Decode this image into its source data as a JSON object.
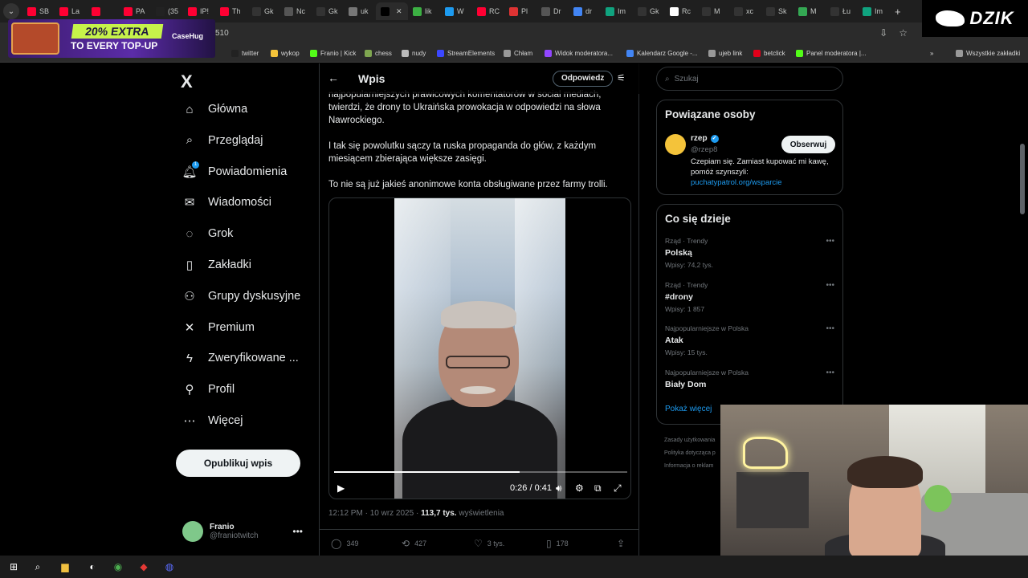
{
  "browser": {
    "tabs": [
      {
        "label": "SB",
        "color": "#ff0033"
      },
      {
        "label": "La",
        "color": "#ff0033"
      },
      {
        "label": "",
        "color": "#ff0033"
      },
      {
        "label": "PA",
        "color": "#ff0033"
      },
      {
        "label": "(35",
        "color": "#222222"
      },
      {
        "label": "IP!",
        "color": "#ff0033"
      },
      {
        "label": "Th",
        "color": "#ff0033"
      },
      {
        "label": "Gk",
        "color": "#333333"
      },
      {
        "label": "Nc",
        "color": "#555555"
      },
      {
        "label": "Gk",
        "color": "#333333"
      },
      {
        "label": "uk",
        "color": "#777777"
      },
      {
        "label": "",
        "color": "#000000"
      },
      {
        "label": "lik",
        "color": "#3cb043"
      },
      {
        "label": "W",
        "color": "#1d9bf0"
      },
      {
        "label": "RC",
        "color": "#ff0033"
      },
      {
        "label": "Pl",
        "color": "#d33"
      },
      {
        "label": "Dr",
        "color": "#555555"
      },
      {
        "label": "dr",
        "color": "#4285f4"
      },
      {
        "label": "Im",
        "color": "#10a37f"
      },
      {
        "label": "Gk",
        "color": "#333333"
      },
      {
        "label": "Rc",
        "color": "#ffffff"
      },
      {
        "label": "M",
        "color": "#333333"
      },
      {
        "label": "xc",
        "color": "#333333"
      },
      {
        "label": "Sk",
        "color": "#333333"
      },
      {
        "label": "M",
        "color": "#34a853"
      },
      {
        "label": "Łu",
        "color": "#333333"
      },
      {
        "label": "Im",
        "color": "#10a37f"
      }
    ],
    "url_fragment": "510",
    "bookmarks": [
      {
        "label": "twitter",
        "color": "#222222"
      },
      {
        "label": "wykop",
        "color": "#f4c33a"
      },
      {
        "label": "Franio | Kick",
        "color": "#53fc18"
      },
      {
        "label": "chess",
        "color": "#7fa650"
      },
      {
        "label": "nudy",
        "color": "#bbbbbb"
      },
      {
        "label": "StreamElements",
        "color": "#3b47ff"
      },
      {
        "label": "Chłam",
        "color": "#999999"
      },
      {
        "label": "Widok moderatora...",
        "color": "#9146ff"
      },
      {
        "label": "Kalendarz Google -...",
        "color": "#4285f4"
      },
      {
        "label": "ujeb link",
        "color": "#999999"
      },
      {
        "label": "betclick",
        "color": "#e2001a"
      },
      {
        "label": "Panel moderatora |...",
        "color": "#53fc18"
      },
      {
        "label": "Wszystkie zakładki",
        "color": "#999999"
      }
    ]
  },
  "promo": {
    "percent": "20% EXTRA",
    "subtitle": "TO EVERY TOP-UP",
    "brand": "CaseHug"
  },
  "streamer_brand": "DZIK",
  "nav": {
    "logo": "X",
    "items": [
      {
        "label": "Główna",
        "icon": "home-icon",
        "glyph": "⌂"
      },
      {
        "label": "Przeglądaj",
        "icon": "search-icon",
        "glyph": "⌕"
      },
      {
        "label": "Powiadomienia",
        "icon": "bell-icon",
        "glyph": "🔔︎",
        "badge": "1"
      },
      {
        "label": "Wiadomości",
        "icon": "mail-icon",
        "glyph": "✉"
      },
      {
        "label": "Grok",
        "icon": "grok-icon",
        "glyph": "◌"
      },
      {
        "label": "Zakładki",
        "icon": "bookmark-icon",
        "glyph": "▯"
      },
      {
        "label": "Grupy dyskusyjne",
        "icon": "people-icon",
        "glyph": "⚇"
      },
      {
        "label": "Premium",
        "icon": "x-icon",
        "glyph": "✕"
      },
      {
        "label": "Zweryfikowane ...",
        "icon": "lightning-icon",
        "glyph": "ϟ"
      },
      {
        "label": "Profil",
        "icon": "person-icon",
        "glyph": "⚲"
      },
      {
        "label": "Więcej",
        "icon": "more-icon",
        "glyph": "⋯"
      }
    ],
    "post_button": "Opublikuj wpis",
    "account": {
      "name": "Franio",
      "handle": "@franiotwitch"
    }
  },
  "post": {
    "header_title": "Wpis",
    "reply_button": "Odpowiedz",
    "paragraphs": [
      "najpopularniejszych prawicowych komentatorów w social mediach, twierdzi, że drony to Ukraińska prowokacja w odpowiedzi na słowa Nawrockiego.",
      "I tak się powolutku sączy ta ruska propaganda do głów, z każdym miesiącem zbierająca większe zasięgi.",
      "To nie są już jakieś anonimowe konta obsługiwane przez farmy trolli."
    ],
    "video": {
      "time": "0:26 / 0:41",
      "progress": 0.634
    },
    "meta": {
      "time": "12:12 PM",
      "date": "10 wrz 2025",
      "views_count": "113,7 tys.",
      "views_label": "wyświetlenia"
    },
    "actions": {
      "replies": "349",
      "reposts": "427",
      "likes": "3 tys.",
      "bookmarks": "178"
    }
  },
  "sidebar": {
    "search_placeholder": "Szukaj",
    "related": {
      "title": "Powiązane osoby",
      "name": "rzep",
      "handle": "@rzep8",
      "follow": "Obserwuj",
      "bio": "Czepiam się. Zamiast kupować mi kawę, pomóż szynszyli:",
      "link": "puchatypatrol.org/wsparcie"
    },
    "trends": {
      "title": "Co się dzieje",
      "items": [
        {
          "category": "Rząd · Trendy",
          "title": "Polską",
          "count": "Wpisy: 74,2 tys."
        },
        {
          "category": "Rząd · Trendy",
          "title": "#drony",
          "count": "Wpisy: 1 857"
        },
        {
          "category": "Najpopularniejsze w Polska",
          "title": "Atak",
          "count": "Wpisy: 15 tys."
        },
        {
          "category": "Najpopularniejsze w Polska",
          "title": "Biały Dom",
          "count": ""
        }
      ],
      "show_more": "Pokaż więcej"
    },
    "footer": [
      "Zasady użytkowania",
      "Polityka dotycząca p",
      "Informacja o reklam"
    ]
  }
}
